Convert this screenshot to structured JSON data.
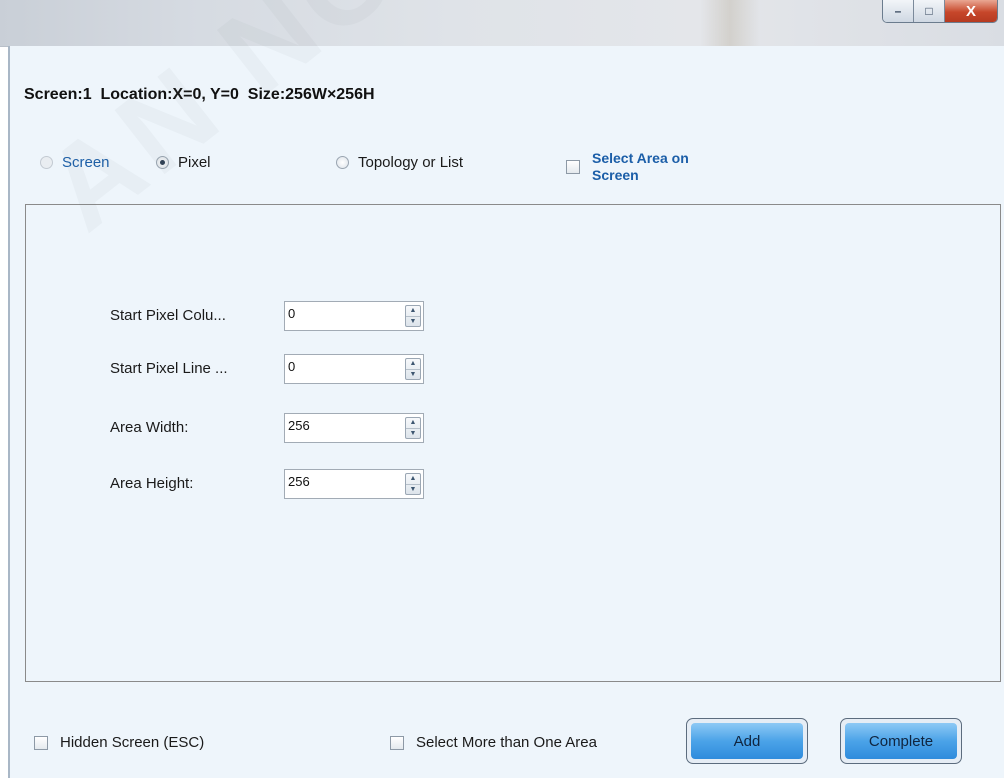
{
  "info": {
    "text": "Screen:1  Location:X=0, Y=0  Size:256W×256H"
  },
  "modes": [
    {
      "label": "Screen",
      "checked": false,
      "disabled": true
    },
    {
      "label": "Pixel",
      "checked": true,
      "disabled": false
    },
    {
      "label": "Topology or List",
      "checked": false,
      "disabled": false
    }
  ],
  "select_area": {
    "label": "Select Area on Screen",
    "checked": false
  },
  "fields": [
    {
      "label": "Start Pixel Colu...",
      "value": "0"
    },
    {
      "label": "Start Pixel Line ...",
      "value": "0"
    },
    {
      "label": "Area Width:",
      "value": "256"
    },
    {
      "label": "Area Height:",
      "value": "256"
    }
  ],
  "footer": {
    "hidden_screen_label": "Hidden Screen (ESC)",
    "select_more_label": "Select More than One Area",
    "add_label": "Add",
    "complete_label": "Complete"
  },
  "window_buttons": {
    "minimize": "–",
    "maximize": "□",
    "close": "X"
  },
  "watermark": "AN NOVAST"
}
